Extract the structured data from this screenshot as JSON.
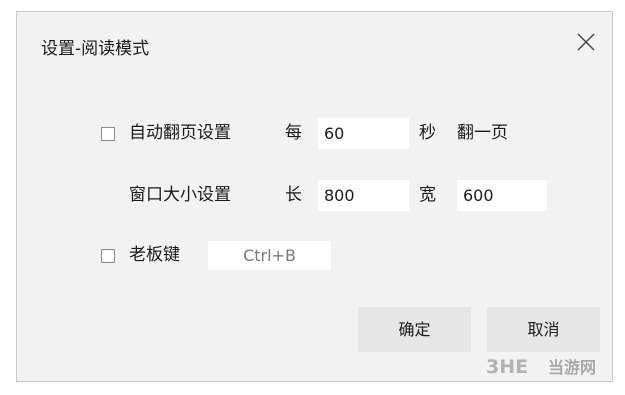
{
  "dialog": {
    "title": "设置-阅读模式",
    "close_icon": "close-icon"
  },
  "auto_page": {
    "checked": false,
    "label": "自动翻页设置",
    "every": "每",
    "seconds_value": "60",
    "seconds_unit": "秒",
    "action": "翻一页"
  },
  "window_size": {
    "label": "窗口大小设置",
    "length_label": "长",
    "length_value": "800",
    "width_label": "宽",
    "width_value": "600"
  },
  "boss_key": {
    "checked": false,
    "label": "老板键",
    "hotkey": "Ctrl+B"
  },
  "buttons": {
    "ok": "确定",
    "cancel": "取消"
  },
  "watermark": {
    "logo": "3HE",
    "text": "当游网"
  },
  "colors": {
    "dialog_bg": "#f2f2f2",
    "button_bg": "#e6e6e6",
    "input_bg": "#ffffff",
    "text": "#1a1a1a"
  }
}
